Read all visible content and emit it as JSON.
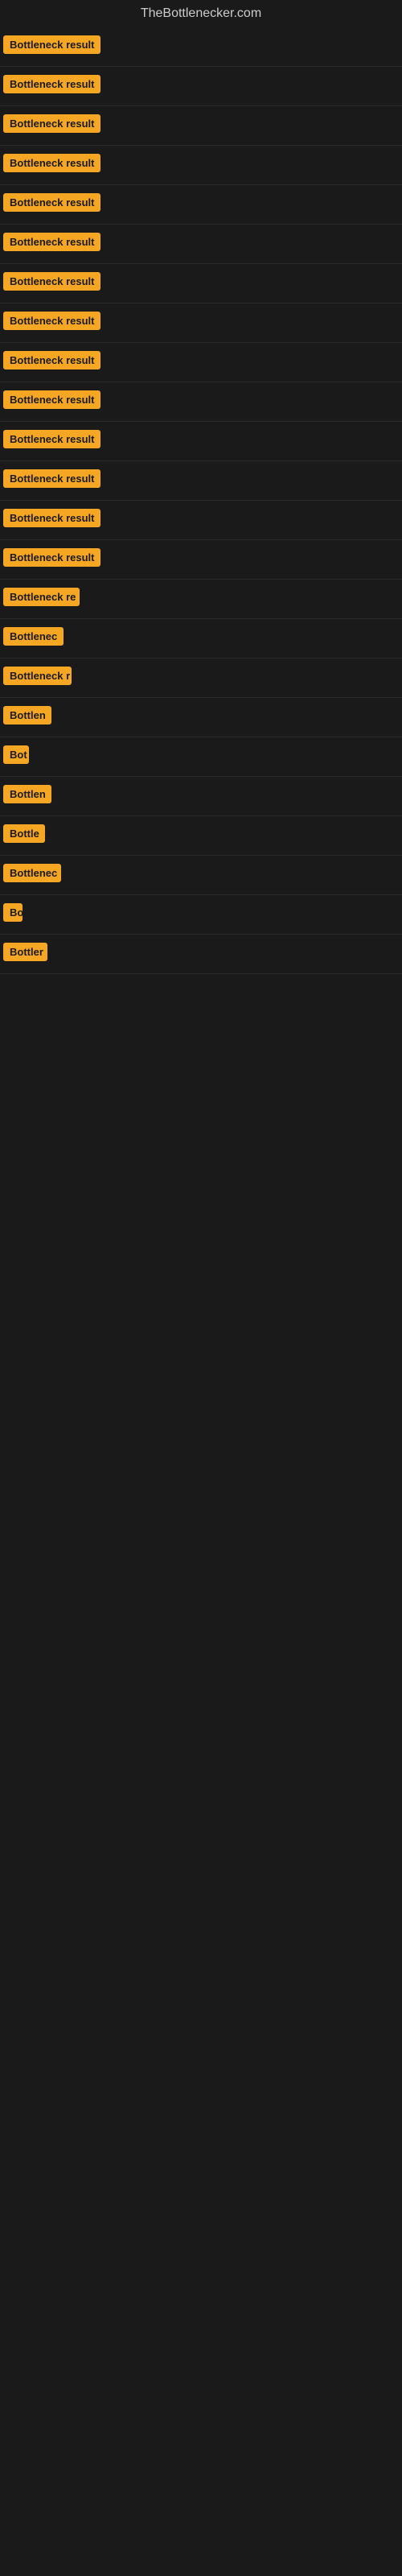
{
  "site": {
    "title": "TheBottlenecker.com"
  },
  "results": [
    {
      "id": 1,
      "label": "Bottleneck result",
      "width": 130
    },
    {
      "id": 2,
      "label": "Bottleneck result",
      "width": 130
    },
    {
      "id": 3,
      "label": "Bottleneck result",
      "width": 130
    },
    {
      "id": 4,
      "label": "Bottleneck result",
      "width": 130
    },
    {
      "id": 5,
      "label": "Bottleneck result",
      "width": 130
    },
    {
      "id": 6,
      "label": "Bottleneck result",
      "width": 130
    },
    {
      "id": 7,
      "label": "Bottleneck result",
      "width": 130
    },
    {
      "id": 8,
      "label": "Bottleneck result",
      "width": 130
    },
    {
      "id": 9,
      "label": "Bottleneck result",
      "width": 130
    },
    {
      "id": 10,
      "label": "Bottleneck result",
      "width": 130
    },
    {
      "id": 11,
      "label": "Bottleneck result",
      "width": 130
    },
    {
      "id": 12,
      "label": "Bottleneck result",
      "width": 130
    },
    {
      "id": 13,
      "label": "Bottleneck result",
      "width": 130
    },
    {
      "id": 14,
      "label": "Bottleneck result",
      "width": 130
    },
    {
      "id": 15,
      "label": "Bottleneck re",
      "width": 95
    },
    {
      "id": 16,
      "label": "Bottlenec",
      "width": 75
    },
    {
      "id": 17,
      "label": "Bottleneck r",
      "width": 85
    },
    {
      "id": 18,
      "label": "Bottlen",
      "width": 60
    },
    {
      "id": 19,
      "label": "Bot",
      "width": 32
    },
    {
      "id": 20,
      "label": "Bottlen",
      "width": 60
    },
    {
      "id": 21,
      "label": "Bottle",
      "width": 52
    },
    {
      "id": 22,
      "label": "Bottlenec",
      "width": 72
    },
    {
      "id": 23,
      "label": "Bo",
      "width": 24
    },
    {
      "id": 24,
      "label": "Bottler",
      "width": 55
    }
  ]
}
